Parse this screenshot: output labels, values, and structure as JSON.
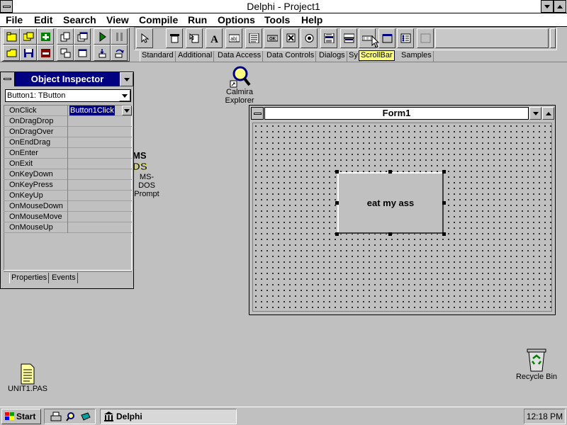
{
  "window": {
    "title": "Delphi - Project1"
  },
  "menu": [
    "File",
    "Edit",
    "Search",
    "View",
    "Compile",
    "Run",
    "Options",
    "Tools",
    "Help"
  ],
  "palette": {
    "tabs": [
      "Standard",
      "Additional",
      "Data Access",
      "Data Controls",
      "Dialogs",
      "Sy",
      "ScrollBar",
      "Samples"
    ],
    "active_tab": "Standard",
    "tooltip": "ScrollBar"
  },
  "desktop_icons": [
    {
      "label_line1": "Calmira",
      "label_line2": "Explorer",
      "icon": "magnifier-icon"
    },
    {
      "label_line1": "MS-DOS",
      "label_line2": "Prompt",
      "icon": "ms-dos-icon"
    },
    {
      "label_line1": "UNIT1.PAS",
      "icon": "document-icon"
    },
    {
      "label_line1": "Recycle Bin",
      "icon": "recycle-bin-icon"
    }
  ],
  "object_inspector": {
    "title": "Object Inspector",
    "selected_component": "Button1: TButton",
    "events": [
      {
        "name": "OnClick",
        "value": "Button1Click"
      },
      {
        "name": "OnDragDrop",
        "value": ""
      },
      {
        "name": "OnDragOver",
        "value": ""
      },
      {
        "name": "OnEndDrag",
        "value": ""
      },
      {
        "name": "OnEnter",
        "value": ""
      },
      {
        "name": "OnExit",
        "value": ""
      },
      {
        "name": "OnKeyDown",
        "value": ""
      },
      {
        "name": "OnKeyPress",
        "value": ""
      },
      {
        "name": "OnKeyUp",
        "value": ""
      },
      {
        "name": "OnMouseDown",
        "value": ""
      },
      {
        "name": "OnMouseMove",
        "value": ""
      },
      {
        "name": "OnMouseUp",
        "value": ""
      }
    ],
    "tabs": [
      "Properties",
      "Events"
    ],
    "active_tab": "Events"
  },
  "form": {
    "title": "Form1",
    "button_caption": "eat my ass"
  },
  "taskbar": {
    "start_label": "Start",
    "task_label": "Delphi",
    "clock": "12:18 PM"
  },
  "colors": {
    "caption_active": "#000080",
    "face": "#c0c0c0",
    "selection": "#000080"
  }
}
